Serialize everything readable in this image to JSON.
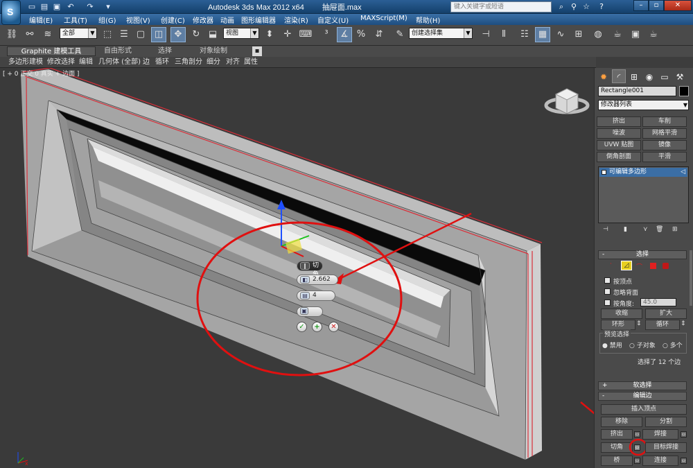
{
  "app": {
    "title": "Autodesk 3ds Max  2012 x64",
    "file": "抽屉面.max",
    "search_placeholder": "键入关键字或短语",
    "logo_letter": "S"
  },
  "quick_access": [
    "new-icon",
    "open-icon",
    "save-icon",
    "undo-icon",
    "redo-icon",
    "dropdown-icon"
  ],
  "menu": [
    "编辑(E)",
    "工具(T)",
    "组(G)",
    "视图(V)",
    "创建(C)",
    "修改器",
    "动画",
    "图形编辑器",
    "渲染(R)",
    "自定义(U)",
    "MAXScript(M)",
    "帮助(H)"
  ],
  "toolbar": {
    "selection_filter": "全部",
    "ref_coord": "视图",
    "named_selection": "创建选择集"
  },
  "ribbon": {
    "tabs": [
      "Graphite 建模工具",
      "自由形式",
      "选择",
      "对象绘制"
    ],
    "sub_items": [
      "多边形建模",
      "修改选择",
      "编辑",
      "几何体 (全部)",
      "边",
      "循环",
      "三角剖分",
      "细分",
      "对齐",
      "属性"
    ]
  },
  "viewport": {
    "label": "[ + 0 正交 0 真实 + 边面 ]",
    "axis_x": "x",
    "caddy": {
      "title": "切角",
      "amount": "2.662",
      "segments": "4",
      "ok": "✓",
      "apply": "+",
      "cancel": "✕"
    }
  },
  "command_panel": {
    "object_name": "Rectangle001",
    "modifier_list": "修改器列表",
    "modifier_buttons": [
      [
        "挤出",
        "车削"
      ],
      [
        "噪波",
        "网格平滑"
      ],
      [
        "UVW 贴图",
        "镜像"
      ],
      [
        "倒角剖面",
        "平滑"
      ]
    ],
    "stack_item": "可编辑多边形",
    "selection": {
      "title": "选择",
      "by_vertex": "按顶点",
      "ignore_backfacing": "忽略背面",
      "by_angle": "按角度:",
      "angle_value": "45.0",
      "shrink": "收缩",
      "grow": "扩大",
      "ring": "环形",
      "loop": "循环",
      "preview_title": "预览选择",
      "preview_disable": "禁用",
      "preview_subobject": "子对象",
      "preview_multi": "多个",
      "status": "选择了 12 个边"
    },
    "soft_selection": "软选择",
    "edit_edges": {
      "title": "编辑边",
      "insert_vertex": "插入顶点",
      "remove": "移除",
      "split": "分割",
      "extrude": "挤出",
      "weld": "焊接",
      "chamfer": "切角",
      "target_weld": "目标焊接",
      "bridge": "桥",
      "connect": "连接"
    }
  },
  "colors": {
    "annotation_red": "#e01010",
    "mesh_gray": "#a9a9a9",
    "selected_edge": "#d9303a",
    "titlebar_blue": "#1f4f82"
  }
}
